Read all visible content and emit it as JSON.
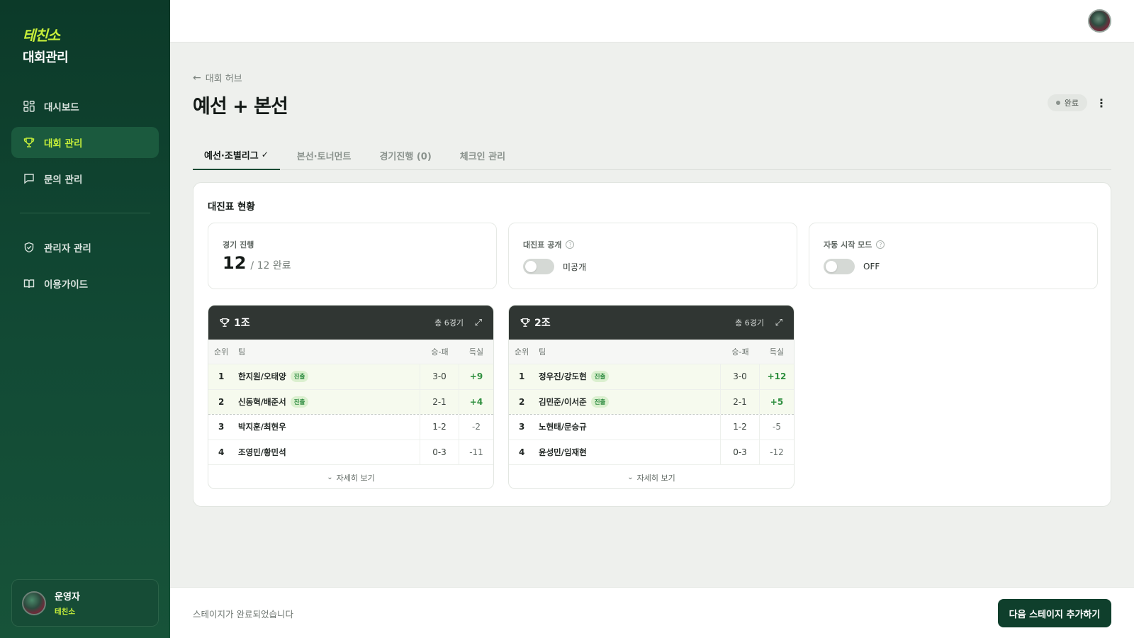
{
  "brand": {
    "logo_mark": "테친소",
    "logo_sub": "대회관리"
  },
  "sidebar": {
    "items": [
      {
        "label": "대시보드",
        "icon": "grid-icon",
        "active": false
      },
      {
        "label": "대회 관리",
        "icon": "trophy-icon",
        "active": true
      },
      {
        "label": "문의 관리",
        "icon": "chat-icon",
        "active": false
      },
      {
        "label": "관리자 관리",
        "icon": "shield-icon",
        "active": false
      },
      {
        "label": "이용가이드",
        "icon": "book-icon",
        "active": false
      }
    ],
    "user": {
      "name": "운영자",
      "org": "테친소"
    }
  },
  "header": {
    "breadcrumb": "대회 허브",
    "title": "예선 + 본선",
    "status": "완료"
  },
  "tabs": [
    {
      "label": "예선·조별리그",
      "active": true,
      "check": "✓"
    },
    {
      "label": "본선·토너먼트",
      "active": false
    },
    {
      "label": "경기진행 (0)",
      "active": false
    },
    {
      "label": "체크인 관리",
      "active": false
    }
  ],
  "panel": {
    "title": "대진표 현황",
    "progress": {
      "label": "경기 진행",
      "done": "12",
      "rest": "/ 12 완료"
    },
    "public": {
      "label": "대진표 공개",
      "value": "미공개",
      "on": false
    },
    "auto": {
      "label": "자동 시작 모드",
      "value": "OFF",
      "on": false
    }
  },
  "groups": [
    {
      "name": "1조",
      "total": "총 6경기",
      "headers": {
        "rank": "순위",
        "team": "팀",
        "wl": "승-패",
        "diff": "득실"
      },
      "rows": [
        {
          "rank": "1",
          "team": "한지원/오태양",
          "badge": "진출",
          "wl": "3-0",
          "diff": "+9"
        },
        {
          "rank": "2",
          "team": "신동혁/배준서",
          "badge": "진출",
          "wl": "2-1",
          "diff": "+4"
        },
        {
          "rank": "3",
          "team": "박지훈/최현우",
          "badge": "",
          "wl": "1-2",
          "diff": "-2"
        },
        {
          "rank": "4",
          "team": "조영민/황민석",
          "badge": "",
          "wl": "0-3",
          "diff": "-11"
        }
      ],
      "more": "자세히 보기"
    },
    {
      "name": "2조",
      "total": "총 6경기",
      "headers": {
        "rank": "순위",
        "team": "팀",
        "wl": "승-패",
        "diff": "득실"
      },
      "rows": [
        {
          "rank": "1",
          "team": "정우진/강도현",
          "badge": "진출",
          "wl": "3-0",
          "diff": "+12"
        },
        {
          "rank": "2",
          "team": "김민준/이서준",
          "badge": "진출",
          "wl": "2-1",
          "diff": "+5"
        },
        {
          "rank": "3",
          "team": "노현태/문승규",
          "badge": "",
          "wl": "1-2",
          "diff": "-5"
        },
        {
          "rank": "4",
          "team": "윤성민/임재현",
          "badge": "",
          "wl": "0-3",
          "diff": "-12"
        }
      ],
      "more": "자세히 보기"
    }
  ],
  "footer": {
    "status_text": "스테이지가 완료되었습니다",
    "next_button": "다음 스테이지 추가하기"
  },
  "colors": {
    "brand_dark": "#0c3a29",
    "accent": "#c7ef3a",
    "positive": "#2f8f3f"
  }
}
